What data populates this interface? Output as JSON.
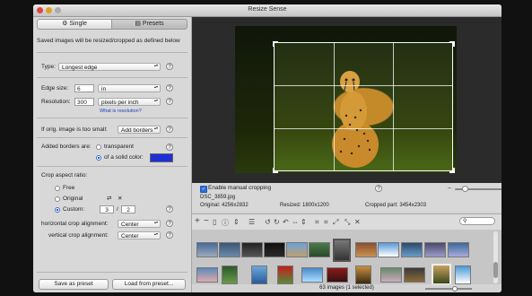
{
  "window": {
    "title": "Resize Sense"
  },
  "tabs": {
    "single": "Single",
    "presets": "Presets"
  },
  "panel": {
    "description": "Saved images will be resized/cropped as defined below",
    "type_label": "Type:",
    "type_value": "Longest edge",
    "edge_label": "Edge size:",
    "edge_value": "6",
    "edge_unit": "in",
    "resolution_label": "Resolution:",
    "resolution_value": "300",
    "resolution_unit": "pixels per inch",
    "what_is_resolution": "What is resolution?",
    "too_small_label": "If orig. image is too small:",
    "too_small_value": "Add borders",
    "borders_label": "Added borders are:",
    "transparent": "transparent",
    "solid": "of a solid color:",
    "border_color": "#1e2fd6",
    "crop_ratio_label": "Crop aspect ratio:",
    "free": "Free",
    "original": "Original",
    "custom": "Custom:",
    "ratio_a": "3",
    "ratio_sep": "/",
    "ratio_b": "2",
    "h_align_label": "horizontal crop alignment:",
    "h_align_value": "Center",
    "v_align_label": "vertical crop alignment:",
    "v_align_value": "Center",
    "save_preset": "Save as preset",
    "load_preset": "Load from preset..."
  },
  "viewer": {
    "manual_crop": "Enable manual cropping",
    "filename": "DSC_3859.jpg",
    "original": "Original: 4256x2832",
    "resized": "Resized: 1800x1200",
    "cropped": "Cropped part: 3454x2303",
    "help": "?",
    "zoom_minus": "−",
    "zoom_plus": "+"
  },
  "toolbar": {
    "add": "+",
    "remove": "−"
  },
  "status": {
    "text": "63 images (1 selected)"
  },
  "icons": {
    "help": "?"
  }
}
